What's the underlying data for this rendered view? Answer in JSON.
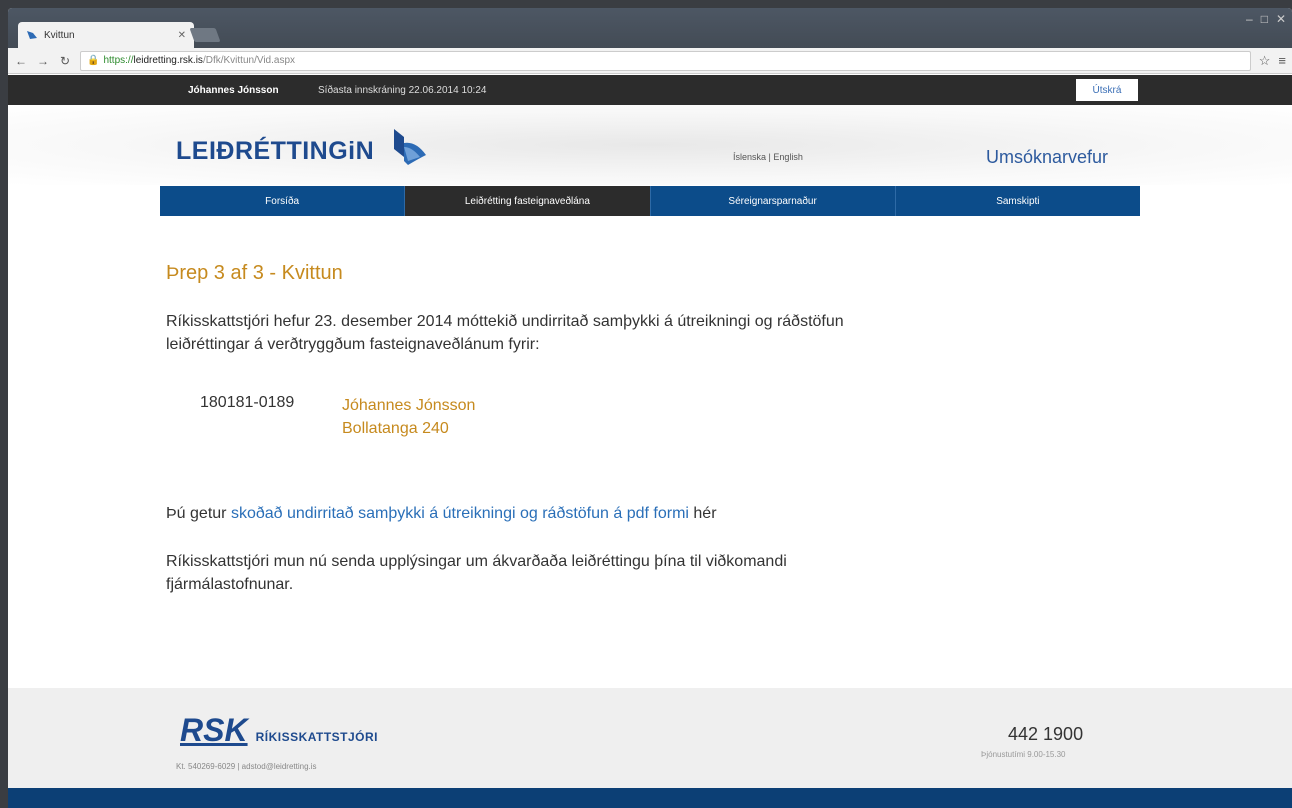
{
  "browser": {
    "tab_title": "Kvittun",
    "url_scheme": "https://",
    "url_host": "leidretting.rsk.is",
    "url_path": "/Dfk/Kvittun/Vid.aspx"
  },
  "userbar": {
    "name": "Jóhannes Jónsson",
    "last_login": "Síðasta innskráning 22.06.2014 10:24",
    "logout": "Útskrá"
  },
  "header": {
    "logo": "LEIÐRÉTTINGiN",
    "langs": "Íslenska | English",
    "portal": "Umsóknarvefur"
  },
  "nav": [
    {
      "label": "Forsíða"
    },
    {
      "label": "Leiðrétting fasteignaveðlána"
    },
    {
      "label": "Séreignarsparnaður"
    },
    {
      "label": "Samskipti"
    }
  ],
  "main": {
    "title": "Þrep 3 af 3 - Kvittun",
    "intro_line1": "Ríkisskattstjóri hefur 23. desember 2014 móttekið undirritað samþykki á útreikningi og ráðstöfun",
    "intro_line2": "leiðréttingar á verðtryggðum fasteignaveðlánum fyrir:",
    "kennitala": "180181-0189",
    "person_name": "Jóhannes Jónsson",
    "person_address": "Bollatanga 240",
    "pdf_prefix": "Þú getur ",
    "pdf_link": "skoðað undirritað samþykki á útreikningi og ráðstöfun á pdf formi",
    "pdf_suffix": " hér",
    "closing_line1": "Ríkisskattstjóri mun nú senda upplýsingar um ákvarðaða leiðréttingu þína til viðkomandi",
    "closing_line2": "fjármálastofnunar."
  },
  "footer": {
    "rsk": "RSK",
    "rsk_name": "RÍKISSKATTSTJÓRI",
    "company_info": "Kt. 540269-6029 | adstod@leidretting.is",
    "phone": "442 1900",
    "hours": "Þjónustutími 9.00-15.30"
  },
  "colors": {
    "brand_blue": "#0c4c8a",
    "accent_gold": "#c68a1e",
    "link_blue": "#2a6fb8"
  }
}
